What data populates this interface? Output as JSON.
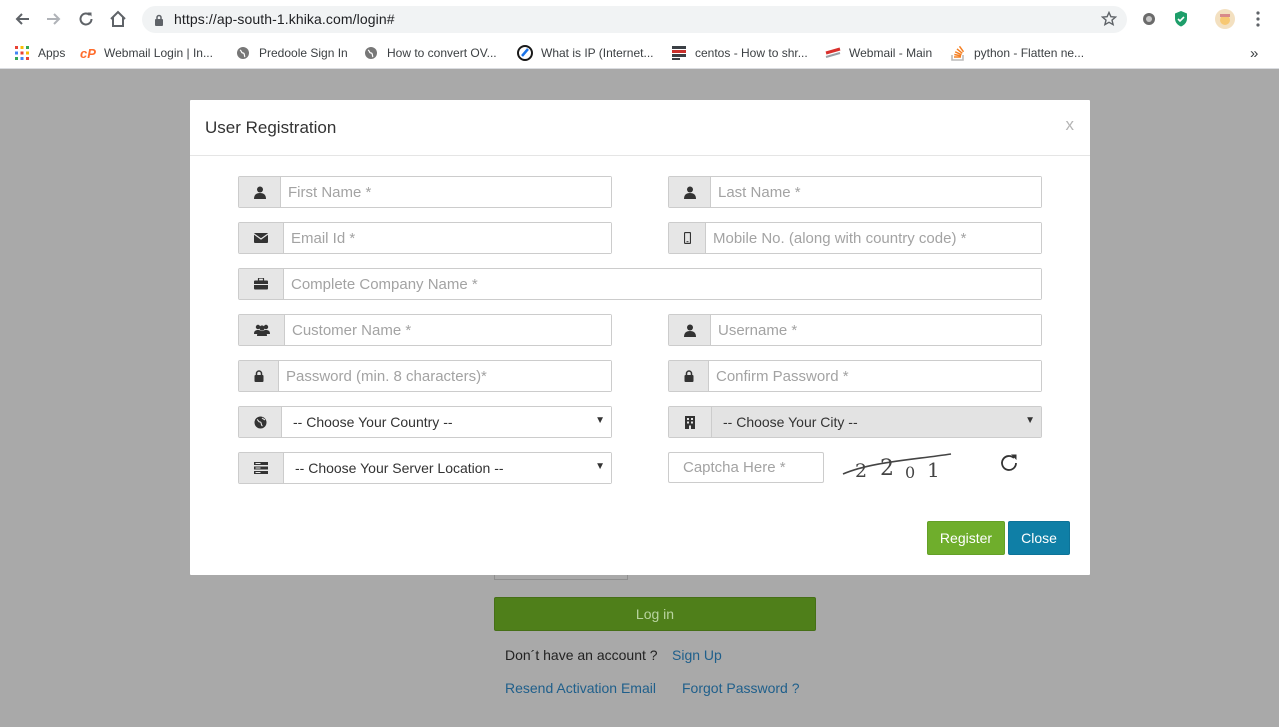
{
  "browser": {
    "url": "https://ap-south-1.khika.com/login#",
    "bookmarks": [
      {
        "label": "Apps",
        "icon": "apps-grid-icon"
      },
      {
        "label": "Webmail Login | In...",
        "icon": "cpanel-icon"
      },
      {
        "label": "Predoole Sign In",
        "icon": "globe-icon"
      },
      {
        "label": "How to convert OV...",
        "icon": "globe-icon"
      },
      {
        "label": "What is IP (Internet...",
        "icon": "site-logo-icon"
      },
      {
        "label": "centos - How to shr...",
        "icon": "stackexchange-icon"
      },
      {
        "label": "Webmail - Main",
        "icon": "webmail-icon"
      },
      {
        "label": "python - Flatten ne...",
        "icon": "stackoverflow-icon"
      }
    ],
    "more_bookmarks": "»"
  },
  "background": {
    "login_button": "Log in",
    "no_account_text": "Don´t have an account ?",
    "sign_up_link": "Sign Up",
    "resend_link": "Resend Activation Email",
    "forgot_link": "Forgot Password ?"
  },
  "modal": {
    "title": "User Registration",
    "close_x": "x",
    "fields": {
      "first_name": "First Name *",
      "last_name": "Last Name *",
      "email": "Email Id *",
      "mobile": "Mobile No. (along with country code) *",
      "company": "Complete Company Name *",
      "customer": "Customer Name *",
      "username": "Username *",
      "password": "Password (min. 8 characters)*",
      "confirm_password": "Confirm Password *",
      "country": "-- Choose Your Country --",
      "city": "-- Choose Your City --",
      "server": "-- Choose Your Server Location --",
      "captcha": "Captcha Here *"
    },
    "captcha_text": "2201",
    "register_button": "Register",
    "close_button": "Close"
  },
  "colors": {
    "register": "#6fae2c",
    "close": "#0f7fa6",
    "login": "#4f7f1a",
    "link": "#1f5f8b",
    "overlay": "#a9a9a9"
  }
}
